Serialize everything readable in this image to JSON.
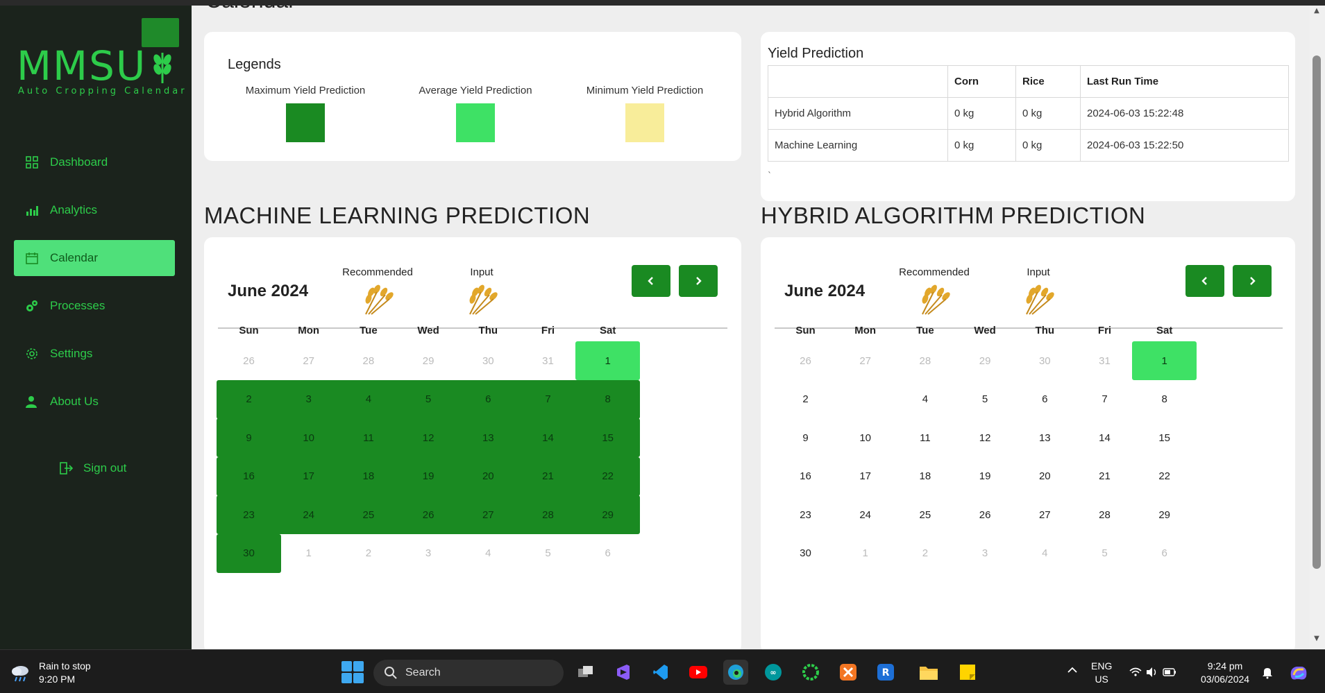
{
  "app": {
    "logo": "MMSU",
    "logo_sub": "Auto Cropping Calendar"
  },
  "nav": {
    "items": [
      {
        "label": "Dashboard",
        "icon": "dashboard-grid-icon"
      },
      {
        "label": "Analytics",
        "icon": "bar-chart-icon"
      },
      {
        "label": "Calendar",
        "icon": "calendar-icon",
        "active": true
      },
      {
        "label": "Processes",
        "icon": "gears-icon"
      },
      {
        "label": "Settings",
        "icon": "gear-icon"
      },
      {
        "label": "About Us",
        "icon": "user-icon"
      }
    ],
    "signout": "Sign out"
  },
  "page": {
    "clipped_title": "Calendar"
  },
  "legends": {
    "title": "Legends",
    "items": [
      {
        "label": "Maximum Yield Prediction",
        "color": "#1a8a22"
      },
      {
        "label": "Average Yield Prediction",
        "color": "#3ee165"
      },
      {
        "label": "Minimum Yield Prediction",
        "color": "#f8ed9a"
      }
    ]
  },
  "yield": {
    "title": "Yield Prediction",
    "headers": [
      "",
      "Corn",
      "Rice",
      "Last Run Time"
    ],
    "rows": [
      [
        "Hybrid Algorithm",
        "0 kg",
        "0 kg",
        "2024-06-03 15:22:48"
      ],
      [
        "Machine Learning",
        "0 kg",
        "0 kg",
        "2024-06-03 15:22:50"
      ]
    ],
    "tick": "`"
  },
  "ml": {
    "section_title": "MACHINE LEARNING PREDICTION",
    "month": "June 2024",
    "recommended": "Recommended",
    "input": "Input"
  },
  "hybrid": {
    "section_title": "HYBRID ALGORITHM PREDICTION",
    "month": "June 2024",
    "recommended": "Recommended",
    "input": "Input"
  },
  "calendar": {
    "dow": [
      "Sun",
      "Mon",
      "Tue",
      "Wed",
      "Thu",
      "Fri",
      "Sat"
    ],
    "ml_days": [
      {
        "d": "26",
        "s": "muted"
      },
      {
        "d": "27",
        "s": "muted"
      },
      {
        "d": "28",
        "s": "muted"
      },
      {
        "d": "29",
        "s": "muted"
      },
      {
        "d": "30",
        "s": "muted"
      },
      {
        "d": "31",
        "s": "muted"
      },
      {
        "d": "1",
        "s": "avg"
      },
      {
        "d": "2",
        "s": "max"
      },
      {
        "d": "3",
        "s": "max"
      },
      {
        "d": "4",
        "s": "max"
      },
      {
        "d": "5",
        "s": "max"
      },
      {
        "d": "6",
        "s": "max"
      },
      {
        "d": "7",
        "s": "max"
      },
      {
        "d": "8",
        "s": "max"
      },
      {
        "d": "9",
        "s": "max"
      },
      {
        "d": "10",
        "s": "max"
      },
      {
        "d": "11",
        "s": "max"
      },
      {
        "d": "12",
        "s": "max"
      },
      {
        "d": "13",
        "s": "max"
      },
      {
        "d": "14",
        "s": "max"
      },
      {
        "d": "15",
        "s": "max"
      },
      {
        "d": "16",
        "s": "max"
      },
      {
        "d": "17",
        "s": "max"
      },
      {
        "d": "18",
        "s": "max"
      },
      {
        "d": "19",
        "s": "max"
      },
      {
        "d": "20",
        "s": "max"
      },
      {
        "d": "21",
        "s": "max"
      },
      {
        "d": "22",
        "s": "max"
      },
      {
        "d": "23",
        "s": "max"
      },
      {
        "d": "24",
        "s": "max"
      },
      {
        "d": "25",
        "s": "max"
      },
      {
        "d": "26",
        "s": "max"
      },
      {
        "d": "27",
        "s": "max"
      },
      {
        "d": "28",
        "s": "max"
      },
      {
        "d": "29",
        "s": "max"
      },
      {
        "d": "30",
        "s": "max"
      },
      {
        "d": "1",
        "s": "muted"
      },
      {
        "d": "2",
        "s": "muted"
      },
      {
        "d": "3",
        "s": "muted"
      },
      {
        "d": "4",
        "s": "muted"
      },
      {
        "d": "5",
        "s": "muted"
      },
      {
        "d": "6",
        "s": "muted"
      }
    ],
    "hybrid_days": [
      {
        "d": "26",
        "s": "muted"
      },
      {
        "d": "27",
        "s": "muted"
      },
      {
        "d": "28",
        "s": "muted"
      },
      {
        "d": "29",
        "s": "muted"
      },
      {
        "d": "30",
        "s": "muted"
      },
      {
        "d": "31",
        "s": "muted"
      },
      {
        "d": "1",
        "s": "avg"
      },
      {
        "d": "2",
        "s": ""
      },
      {
        "d": "",
        "s": ""
      },
      {
        "d": "4",
        "s": ""
      },
      {
        "d": "5",
        "s": ""
      },
      {
        "d": "6",
        "s": ""
      },
      {
        "d": "7",
        "s": ""
      },
      {
        "d": "8",
        "s": ""
      },
      {
        "d": "9",
        "s": ""
      },
      {
        "d": "10",
        "s": ""
      },
      {
        "d": "11",
        "s": ""
      },
      {
        "d": "12",
        "s": ""
      },
      {
        "d": "13",
        "s": ""
      },
      {
        "d": "14",
        "s": ""
      },
      {
        "d": "15",
        "s": ""
      },
      {
        "d": "16",
        "s": ""
      },
      {
        "d": "17",
        "s": ""
      },
      {
        "d": "18",
        "s": ""
      },
      {
        "d": "19",
        "s": ""
      },
      {
        "d": "20",
        "s": ""
      },
      {
        "d": "21",
        "s": ""
      },
      {
        "d": "22",
        "s": ""
      },
      {
        "d": "23",
        "s": ""
      },
      {
        "d": "24",
        "s": ""
      },
      {
        "d": "25",
        "s": ""
      },
      {
        "d": "26",
        "s": ""
      },
      {
        "d": "27",
        "s": ""
      },
      {
        "d": "28",
        "s": ""
      },
      {
        "d": "29",
        "s": ""
      },
      {
        "d": "30",
        "s": ""
      },
      {
        "d": "1",
        "s": "muted"
      },
      {
        "d": "2",
        "s": "muted"
      },
      {
        "d": "3",
        "s": "muted"
      },
      {
        "d": "4",
        "s": "muted"
      },
      {
        "d": "5",
        "s": "muted"
      },
      {
        "d": "6",
        "s": "muted"
      }
    ]
  },
  "taskbar": {
    "weather_line1": "Rain to stop",
    "weather_line2": "9:20 PM",
    "search": "Search",
    "lang_line1": "ENG",
    "lang_line2": "US",
    "time": "9:24 pm",
    "date": "03/06/2024"
  }
}
